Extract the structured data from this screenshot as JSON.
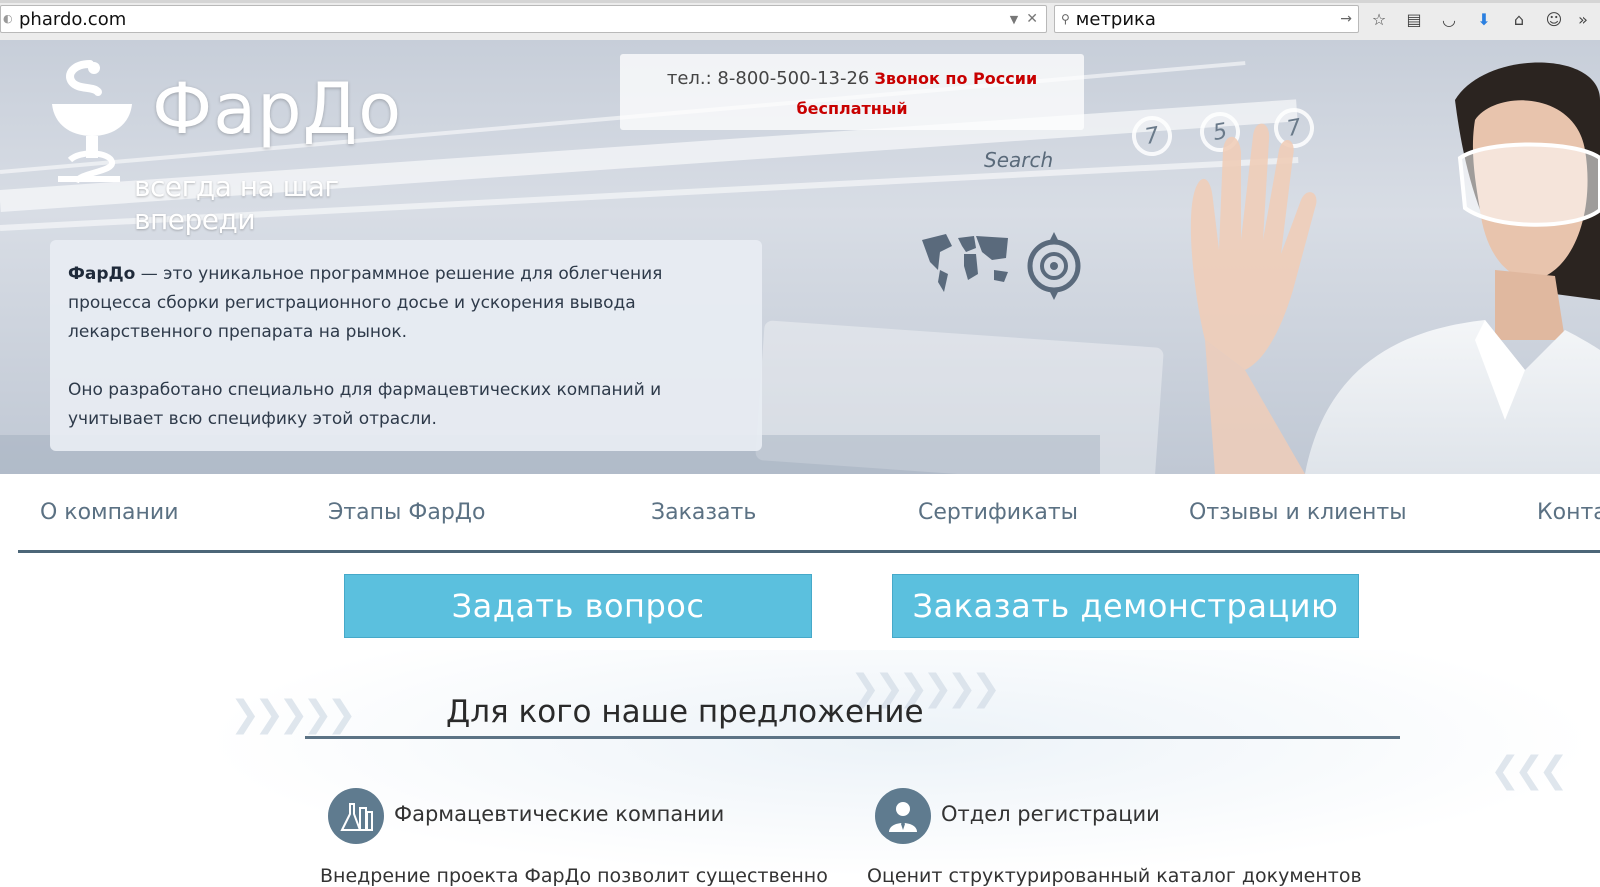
{
  "browser": {
    "url": "phardo.com",
    "search_query": "метрика"
  },
  "hero": {
    "brand": "ФарДо",
    "slogan": "всегда на шаг впереди",
    "phone": "тел.: 8-800-500-13-26",
    "call_note_1": "Звонок по России",
    "call_note_2": "бесплатный",
    "hud_search": "Search",
    "hud_numbers": [
      "7",
      "5",
      "7"
    ],
    "desc_brand": "ФарДо",
    "desc_p1": " — это уникальное программное решение для облегчения процесса сборки регистрационного досье и ускорения вывода лекарственного препарата на рынок.",
    "desc_p2": "Оно разработано специально для фармацевтических компаний и учитывает всю специфику этой отрасли."
  },
  "nav": {
    "items": [
      "О компании",
      "Этапы ФарДо",
      "Заказать",
      "Сертификаты",
      "Отзывы и клиенты",
      "Конта"
    ]
  },
  "buttons": {
    "ask": "Задать вопрос",
    "demo": "Заказать демонстрацию"
  },
  "section": {
    "title": "Для кого наше предложение",
    "audiences": [
      {
        "title": "Фармацевтические компании",
        "text": "Внедрение проекта ФарДо позволит существенно"
      },
      {
        "title": "Отдел регистрации",
        "text": "Оценит структурированный каталог документов"
      }
    ]
  },
  "colors": {
    "accent_button": "#5bc0de",
    "nav_text": "#5b7183",
    "rule": "#4c6678",
    "call_note": "#c80000"
  }
}
